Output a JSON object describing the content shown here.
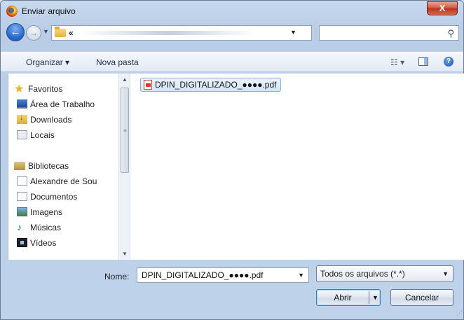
{
  "window": {
    "title": "Enviar arquivo",
    "close_label": "X"
  },
  "address": {
    "crumb_arrows": "«"
  },
  "search": {
    "placeholder": ""
  },
  "toolbar": {
    "organize_label": "Organizar ▾",
    "new_folder_label": "Nova pasta",
    "views_label": "☷ ▾",
    "help_label": "?"
  },
  "nav": {
    "items": [
      {
        "label": "Favoritos",
        "icon": "star-icon",
        "group": true
      },
      {
        "label": "Área de Trabalho",
        "icon": "desktop-icon"
      },
      {
        "label": "Downloads",
        "icon": "downloads-folder-icon"
      },
      {
        "label": "Locais",
        "icon": "places-icon"
      },
      {
        "label": "Bibliotecas",
        "icon": "libraries-icon",
        "group": true
      },
      {
        "label": "Alexandre de Sou",
        "icon": "library-doc-icon"
      },
      {
        "label": "Documentos",
        "icon": "documents-icon"
      },
      {
        "label": "Imagens",
        "icon": "pictures-icon"
      },
      {
        "label": "Músicas",
        "icon": "music-icon"
      },
      {
        "label": "Vídeos",
        "icon": "videos-icon"
      }
    ]
  },
  "files": [
    {
      "name": "DPIN_DIGITALIZADO_●●●●.pdf",
      "icon": "pdf-file-icon",
      "selected": true
    }
  ],
  "footer": {
    "name_label": "Nome:",
    "name_value": "DPIN_DIGITALIZADO_●●●●.pdf",
    "type_value": "Todos os arquivos (*.*)",
    "open_label": "Abrir",
    "cancel_label": "Cancelar"
  }
}
